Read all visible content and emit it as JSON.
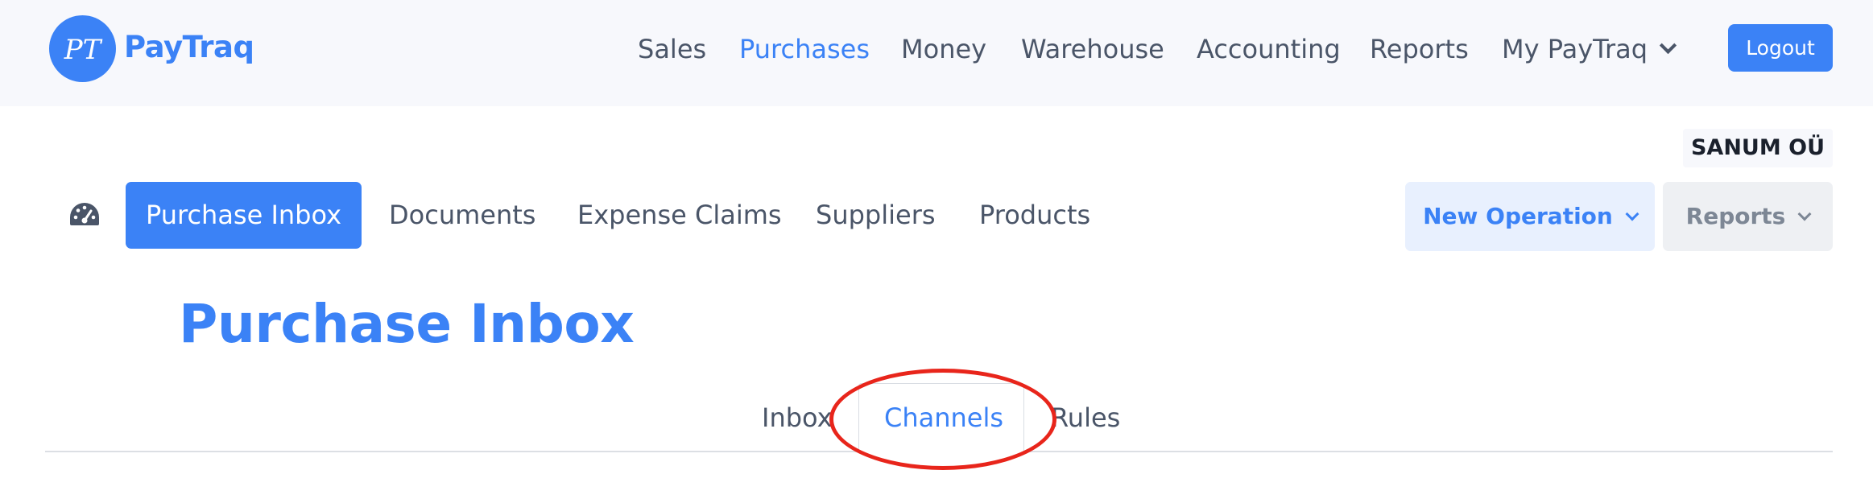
{
  "brand": {
    "name": "PayTraq",
    "logo_initials": "PT",
    "accent_color": "#3b82f6"
  },
  "top_nav": {
    "items": [
      {
        "label": "Sales",
        "active": false
      },
      {
        "label": "Purchases",
        "active": true
      },
      {
        "label": "Money",
        "active": false
      },
      {
        "label": "Warehouse",
        "active": false
      },
      {
        "label": "Accounting",
        "active": false
      },
      {
        "label": "Reports",
        "active": false
      },
      {
        "label": "My PayTraq",
        "active": false,
        "has_dropdown": true
      }
    ],
    "logout_label": "Logout"
  },
  "company_name": "SANUM OÜ",
  "sub_nav": {
    "dashboard_icon": "speedometer-icon",
    "items": [
      {
        "label": "Purchase Inbox",
        "active": true
      },
      {
        "label": "Documents",
        "active": false
      },
      {
        "label": "Expense Claims",
        "active": false
      },
      {
        "label": "Suppliers",
        "active": false
      },
      {
        "label": "Products",
        "active": false
      }
    ],
    "new_operation_label": "New Operation",
    "reports_label": "Reports"
  },
  "page": {
    "title": "Purchase Inbox",
    "tabs": [
      {
        "label": "Inbox",
        "active": false
      },
      {
        "label": "Channels",
        "active": true
      },
      {
        "label": "Rules",
        "active": false
      }
    ]
  },
  "annotation": {
    "shape": "ellipse",
    "color": "#e8251b",
    "target": "Channels"
  }
}
